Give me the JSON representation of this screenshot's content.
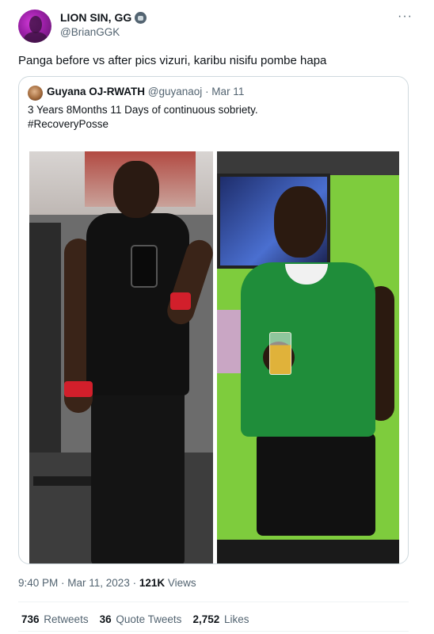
{
  "author": {
    "display_name": "LION SIN, GG",
    "handle": "@BrianGGK",
    "badge_icon": "gorilla-emoji-icon"
  },
  "tweet": {
    "text": "Panga before vs after pics vizuri, karibu nisifu pombe hapa",
    "time": "9:40 PM · Mar 11, 2023 · ",
    "views_count": "121K",
    "views_label": "Views"
  },
  "quote": {
    "display_name": "Guyana OJ-RWATH",
    "handle": "@guyanaoj",
    "date": " · Mar 11",
    "line1": "3 Years 8Months 11 Days of continuous sobriety.",
    "line2": "#RecoveryPosse"
  },
  "stats": {
    "retweets_count": "736",
    "retweets_label": "Retweets",
    "quotes_count": "36",
    "quotes_label": "Quote Tweets",
    "likes_count": "2,752",
    "likes_label": "Likes"
  },
  "more_icon": "more-options-icon",
  "more_text": "···"
}
